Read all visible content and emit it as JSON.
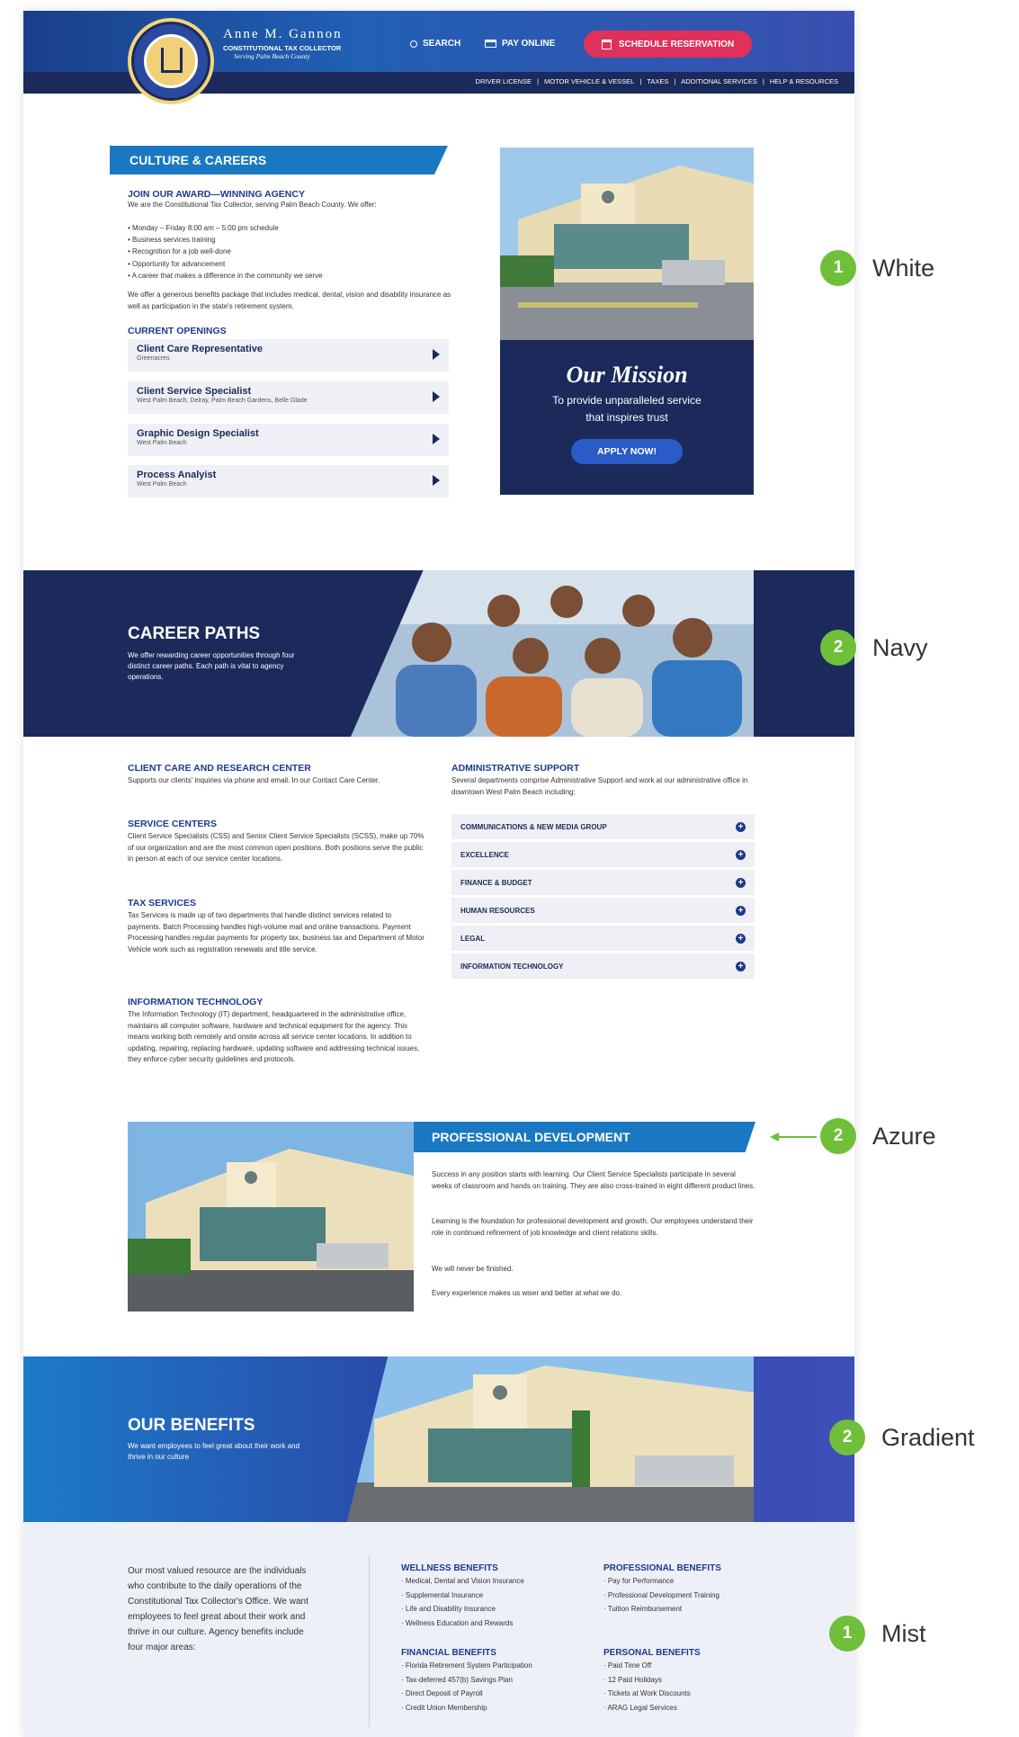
{
  "header": {
    "brand_name": "Anne M. Gannon",
    "brand_title": "CONSTITUTIONAL TAX COLLECTOR",
    "brand_sub": "Serving Palm Beach County",
    "seal_text": "TAX COLLECTOR PALM BEACH COUNTY FLORIDA",
    "search_label": "SEARCH",
    "pay_label": "PAY ONLINE",
    "schedule_label": "SCHEDULE RESERVATION",
    "subnav": [
      "DRIVER LICENSE",
      "MOTOR VEHICLE & VESSEL",
      "TAXES",
      "ADDITIONAL SERVICES",
      "HELP & RESOURCES"
    ],
    "divider": "|"
  },
  "culture": {
    "heading": "CULTURE & CAREERS",
    "join_title": "JOIN OUR AWARD—WINNING AGENCY",
    "join_text": "We are the Constitutional Tax Collector, serving Palm Beach County. We offer:",
    "bullets": [
      "Monday – Friday 8:00 am – 5:00 pm schedule",
      "Business services training",
      "Recognition for a job well-done",
      "Opportunity for advancement",
      "A career that makes a difference in the community we serve"
    ],
    "benefits_text": "We offer a generous benefits package that includes medical, dental, vision and disability insurance as well as participation in the state's retirement system.",
    "openings_title": "CURRENT OPENINGS",
    "jobs": [
      {
        "title": "Client Care Representative",
        "location": "Greenacres"
      },
      {
        "title": "Client Service Specialist",
        "location": "West Palm Beach, Delray, Palm Beach Gardens, Belle Glade"
      },
      {
        "title": "Graphic Design Specialist",
        "location": "West Palm Beach"
      },
      {
        "title": "Process Analyist",
        "location": "West Palm Beach"
      }
    ]
  },
  "mission": {
    "title": "Our Mission",
    "line1": "To provide unparalleled service",
    "line2": "that inspires trust",
    "button": "APPLY NOW!"
  },
  "career_paths": {
    "heading": "CAREER PATHS",
    "text": "We offer rewarding career opportunities through four distinct career paths. Each path is vital to agency operations.",
    "sections": [
      {
        "title": "CLIENT CARE AND RESEARCH CENTER",
        "text": "Supports our clients' inquiries via phone and email. In our Contact Care Center."
      },
      {
        "title": "SERVICE CENTERS",
        "text": "Client Service Specialists (CSS) and Senior Client Service Specialists (SCSS), make up 70% of our organization and are the most common open positions. Both positions serve the public in person at each of our service center locations."
      },
      {
        "title": "TAX SERVICES",
        "text": "Tax Services is made up of two departments that handle distinct services related to payments. Batch Processing handles high-volume mail and online transactions. Payment Processing handles regular payments for property tax, business tax and Department of Motor Vehicle work such as registration renewals and title service."
      },
      {
        "title": "INFORMATION TECHNOLOGY",
        "text": "The Information Technology (IT) department, headquartered in the administrative office, maintains all computer software, hardware and technical equipment for the agency. This means working both remotely and onsite across all service center locations. In addition to updating, repairing, replacing hardware, updating software and addressing technical issues, they enforce cyber security guidelines and protocols."
      }
    ],
    "admin_title": "ADMINISTRATIVE SUPPORT",
    "admin_text": "Several departments comprise Administrative Support and work at our administrative office in downtown West Palm Beach including:",
    "admin_items": [
      "COMMUNICATIONS & NEW MEDIA GROUP",
      "EXCELLENCE",
      "FINANCE & BUDGET",
      "HUMAN RESOURCES",
      "LEGAL",
      "INFORMATION TECHNOLOGY"
    ]
  },
  "prof_dev": {
    "heading": "PROFESSIONAL DEVELOPMENT",
    "p1": "Success in any position starts with learning. Our Client Service Specialists participate in several weeks of classroom and hands on training. They are also cross-trained in eight different product lines.",
    "p2": "Learning is the foundation for professional development and growth. Our employees understand their role in continued refinement of job knowledge and client relations skills.",
    "p3": "We will never be finished.",
    "p4": "Every experience makes us wiser and better at what we do."
  },
  "benefits": {
    "heading": "OUR BENEFITS",
    "text": "We want employees to feel great about their work and thrive in our culture",
    "intro": "Our most valued resource are the individuals who contribute to the daily operations of the Constitutional Tax Collector's Office. We want employees to feel great about their work and thrive in our culture. Agency benefits include four major areas:",
    "groups": [
      {
        "title": "WELLNESS BENEFITS",
        "items": [
          "Medical, Dental and Vision Insurance",
          "Supplemental Insurance",
          "Life and Disability Insurance",
          "Wellness Education and Rewards"
        ]
      },
      {
        "title": "PROFESSIONAL BENEFITS",
        "items": [
          "Pay for Performance",
          "Professional Development Training",
          "Tuition Reimbursement"
        ]
      },
      {
        "title": "FINANCIAL BENEFITS",
        "items": [
          "Florida Retirement System Participation",
          "Tax-deferred 457(b) Savings Plan",
          "Direct Deposit of Payroll",
          "Credit Union Membership"
        ]
      },
      {
        "title": "PERSONAL BENEFITS",
        "items": [
          "Paid Time Off",
          "12 Paid Holidays",
          "Tickets at Work Discounts",
          "ARAG Legal Services"
        ]
      }
    ]
  },
  "annotations": [
    {
      "badge": "1",
      "label": "White"
    },
    {
      "badge": "2",
      "label": "Navy"
    },
    {
      "badge": "2",
      "label": "Azure"
    },
    {
      "badge": "2",
      "label": "Gradient"
    },
    {
      "badge": "1",
      "label": "Mist"
    }
  ],
  "colors": {
    "navy": "#1b2a5a",
    "azure": "#1a78c2",
    "mist": "#eef0f7",
    "accent_red": "#e0315a",
    "badge_green": "#6fbf3a"
  }
}
